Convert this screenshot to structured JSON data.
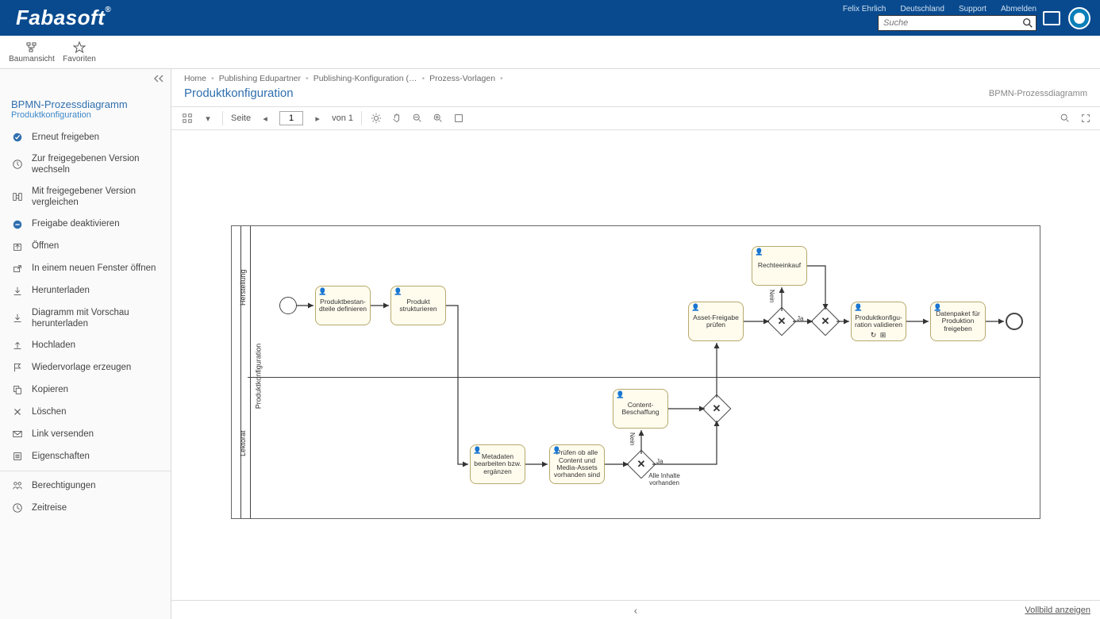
{
  "brand": "Fabasoft",
  "top_links": [
    "Felix Ehrlich",
    "Deutschland",
    "Support",
    "Abmelden"
  ],
  "search": {
    "placeholder": "Suche"
  },
  "sub_toolbar": {
    "tree": "Baumansicht",
    "fav": "Favoriten"
  },
  "sidebar": {
    "title": "BPMN-Prozessdiagramm",
    "subtitle": "Produktkonfiguration",
    "actions": [
      "Erneut freigeben",
      "Zur freigegebenen Version wechseln",
      "Mit freigegebener Version vergleichen",
      "Freigabe deaktivieren",
      "Öffnen",
      "In einem neuen Fenster öffnen",
      "Herunterladen",
      "Diagramm mit Vorschau herunterladen",
      "Hochladen",
      "Wiedervorlage erzeugen",
      "Kopieren",
      "Löschen",
      "Link versenden",
      "Eigenschaften"
    ],
    "actions2": [
      "Berechtigungen",
      "Zeitreise"
    ]
  },
  "breadcrumbs": [
    "Home",
    "Publishing Edupartner",
    "Publishing-Konfiguration (…",
    "Prozess-Vorlagen"
  ],
  "page_title": "Produktkonfiguration",
  "view_label": "BPMN-Prozessdiagramm",
  "toolbar2": {
    "page_label": "Seite",
    "page_val": "1",
    "page_total": "von 1"
  },
  "diagram": {
    "pool": "Produktkonfiguration",
    "lane_top": "Herstellung",
    "lane_bot": "Lektorat",
    "tasks": {
      "t1": "Produktbestan­dteile definieren",
      "t2": "Produkt strukturieren",
      "t3": "Metadaten bearbeiten bzw. ergänzen",
      "t4": "Prüfen ob alle Content und Media-Assets vorhanden sind",
      "t5": "Content-Beschaffung",
      "t6": "Asset-Freigabe prüfen",
      "t7": "Rechteeinkauf",
      "t8": "Produktkonfigu­ration validieren",
      "t9": "Datenpaket für Produktion freigeben"
    },
    "labels": {
      "g1_yes": "Ja",
      "g1_no": "Nein",
      "g1_below": "Alle Inhalte vorhanden",
      "g2_yes": "Ja",
      "g2_no": "Nein"
    }
  },
  "footer": {
    "fullscreen": "Vollbild anzeigen"
  }
}
